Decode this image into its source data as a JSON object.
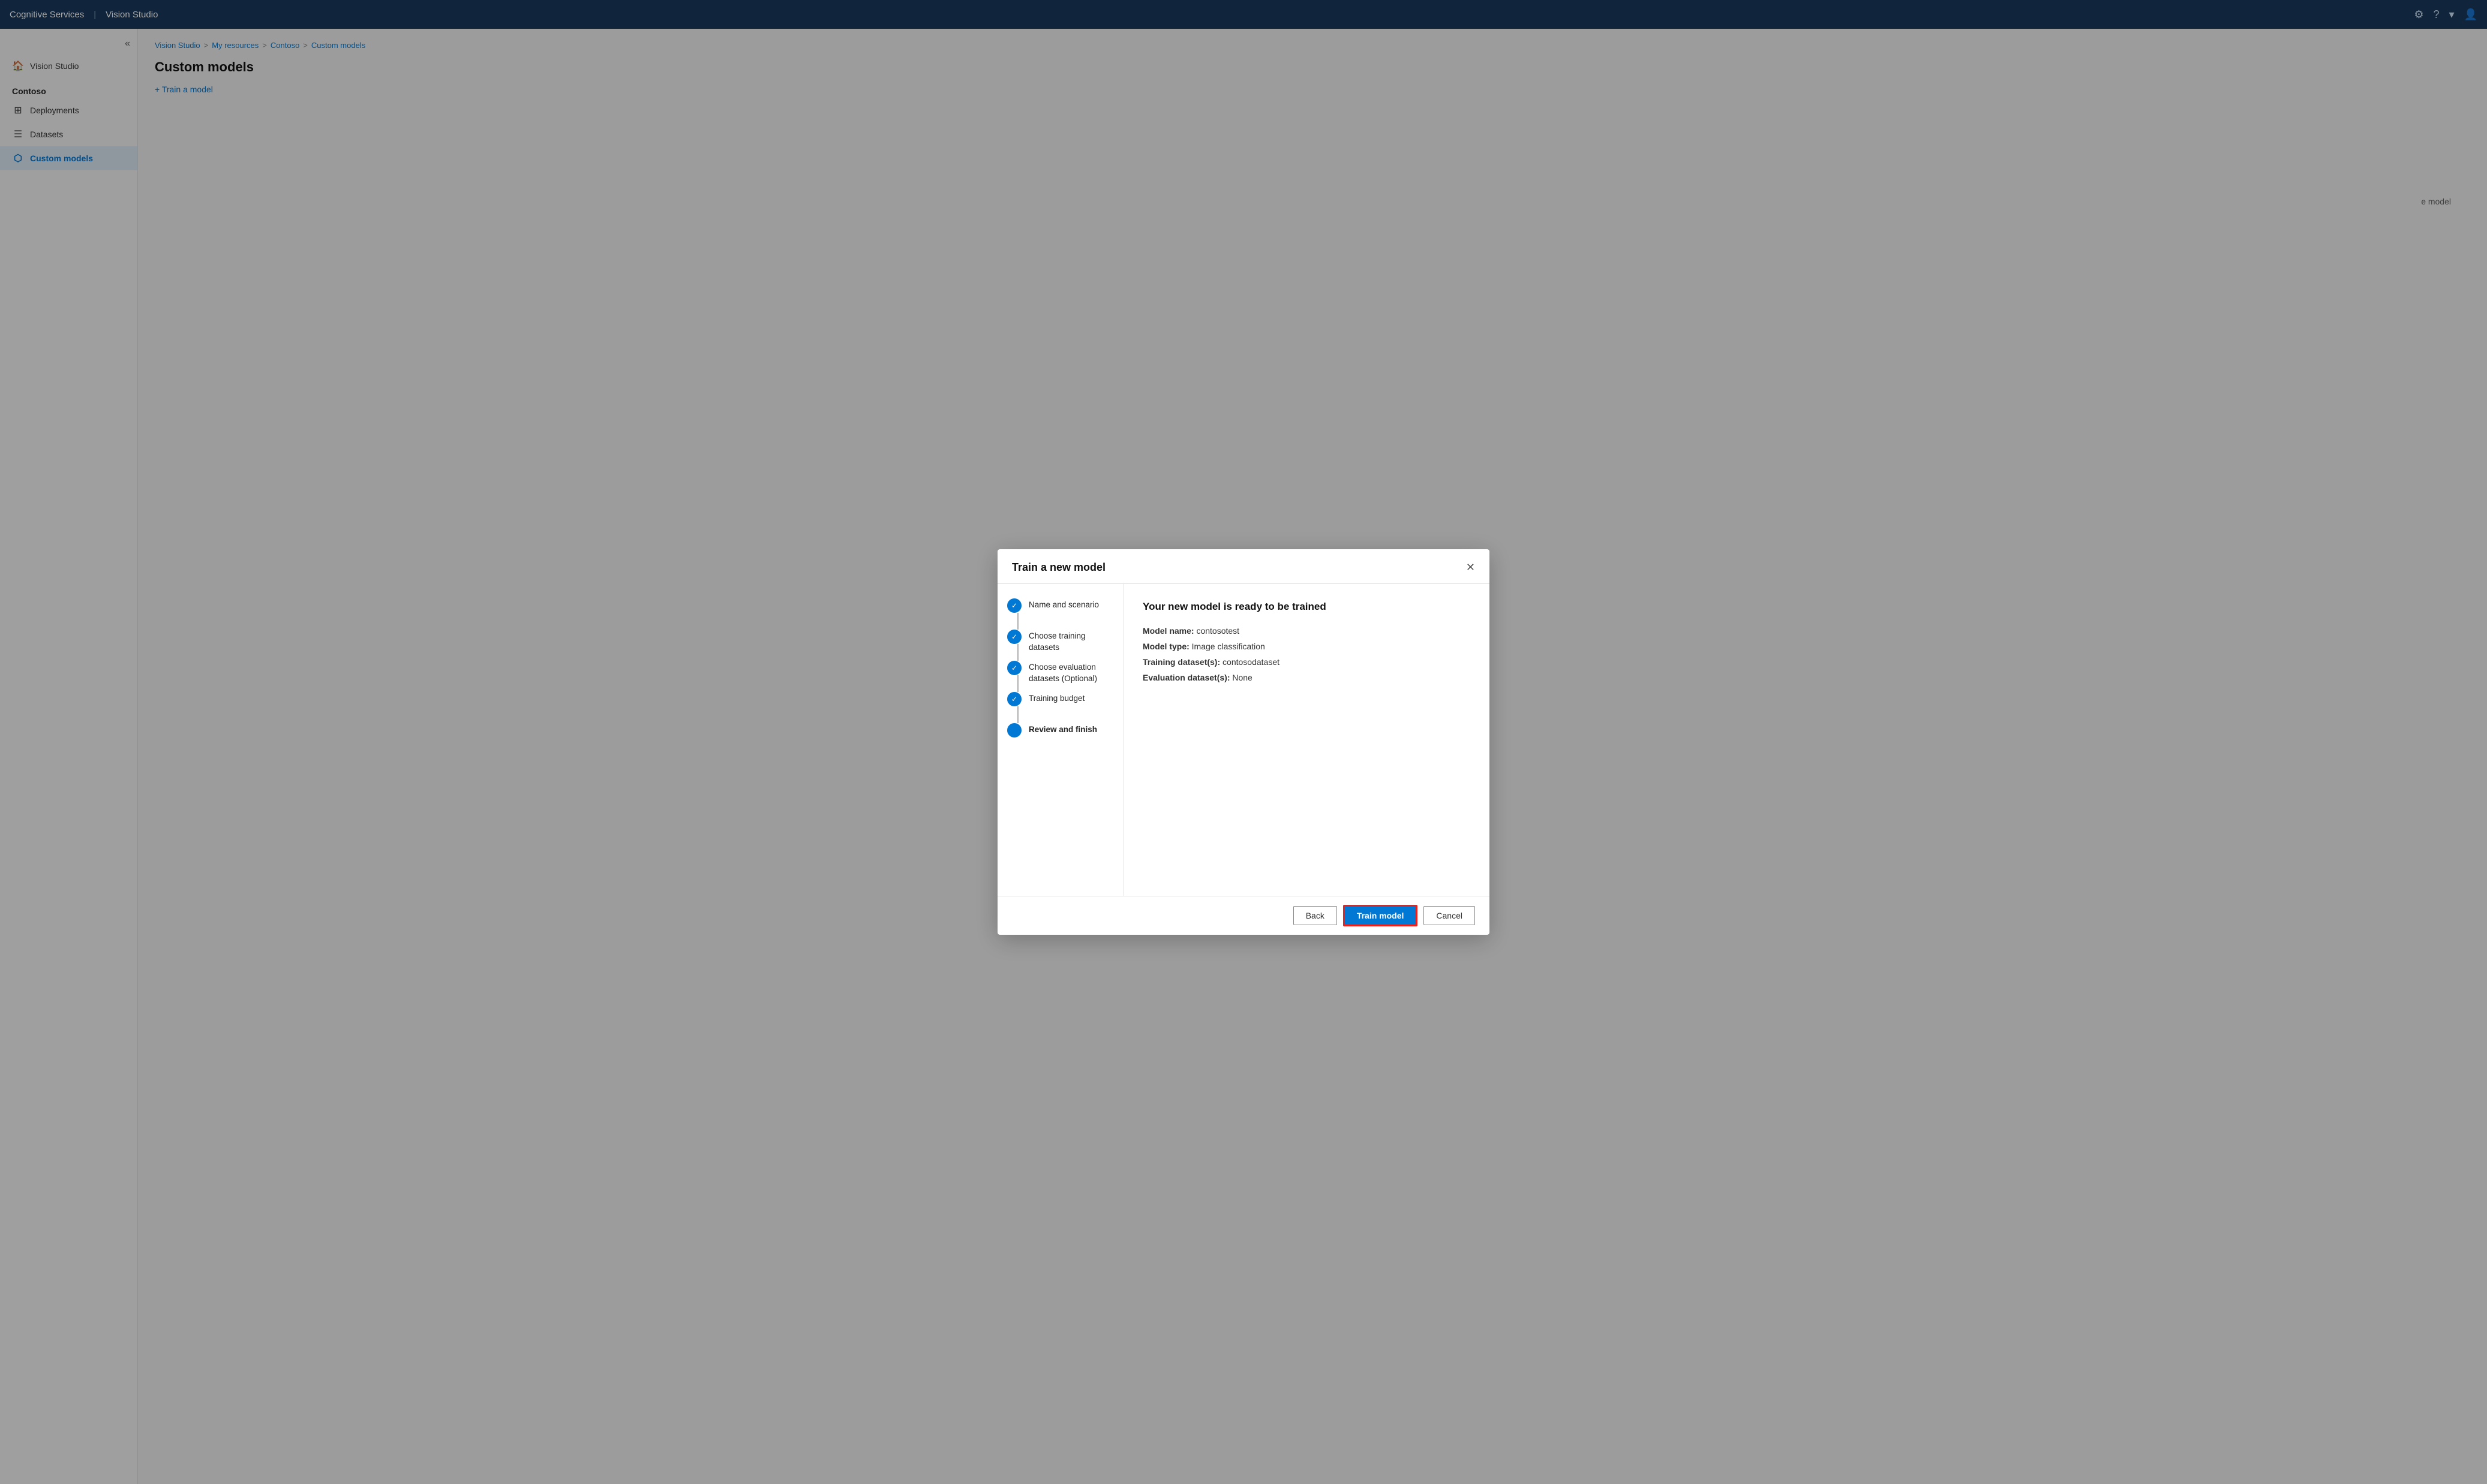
{
  "topbar": {
    "brand": "Cognitive Services",
    "divider": "|",
    "product": "Vision Studio",
    "settings_icon": "⚙",
    "help_icon": "?",
    "chevron_icon": "▾",
    "user_icon": "👤"
  },
  "sidebar": {
    "collapse_icon": "«",
    "nav_items": [
      {
        "id": "vision-studio",
        "label": "Vision Studio",
        "icon": "🏠",
        "active": false
      },
      {
        "id": "section-contoso",
        "label": "Contoso",
        "type": "section"
      },
      {
        "id": "deployments",
        "label": "Deployments",
        "icon": "⊞",
        "active": false
      },
      {
        "id": "datasets",
        "label": "Datasets",
        "icon": "☰",
        "active": false
      },
      {
        "id": "custom-models",
        "label": "Custom models",
        "icon": "⬡",
        "active": true
      }
    ]
  },
  "breadcrumb": {
    "items": [
      {
        "label": "Vision Studio"
      },
      {
        "label": "My resources"
      },
      {
        "label": "Contoso"
      },
      {
        "label": "Custom models"
      }
    ],
    "separator": ">"
  },
  "page": {
    "title": "Custom models",
    "train_button_label": "+ Train a model"
  },
  "background": {
    "hint_text": "e model"
  },
  "dialog": {
    "title": "Train a new model",
    "close_icon": "✕",
    "steps": [
      {
        "id": "name-scenario",
        "label": "Name and scenario",
        "state": "completed",
        "check": "✓"
      },
      {
        "id": "training-datasets",
        "label": "Choose training datasets",
        "state": "completed",
        "check": "✓"
      },
      {
        "id": "eval-datasets",
        "label": "Choose evaluation datasets (Optional)",
        "state": "completed",
        "check": "✓"
      },
      {
        "id": "training-budget",
        "label": "Training budget",
        "state": "completed",
        "check": "✓"
      },
      {
        "id": "review-finish",
        "label": "Review and finish",
        "state": "active",
        "check": ""
      }
    ],
    "content": {
      "heading": "Your new model is ready to be trained",
      "fields": [
        {
          "label": "Model name:",
          "value": "contosotest"
        },
        {
          "label": "Model type:",
          "value": "Image classification"
        },
        {
          "label": "Training dataset(s):",
          "value": "contosodataset"
        },
        {
          "label": "Evaluation dataset(s):",
          "value": "None"
        }
      ]
    },
    "footer": {
      "back_label": "Back",
      "train_label": "Train model",
      "cancel_label": "Cancel"
    }
  }
}
